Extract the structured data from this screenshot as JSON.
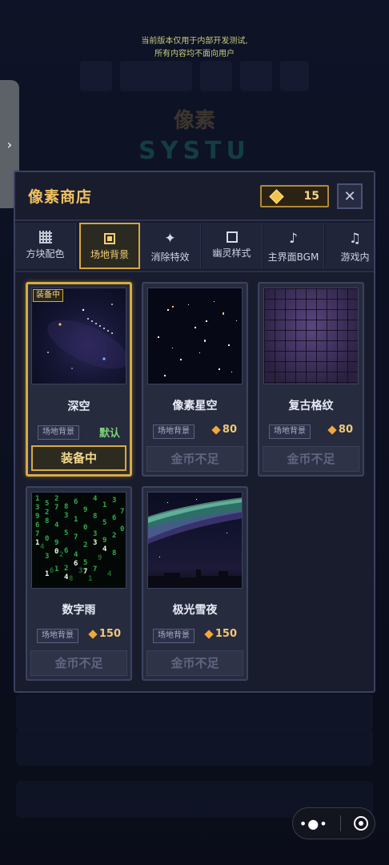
{
  "notice": {
    "line1": "当前版本仅用于内部开发测试,",
    "line2": "所有内容均不面向用户"
  },
  "side_tab": {
    "icon": "chevron-right-icon",
    "glyph": "›"
  },
  "background": {
    "title1": "像素",
    "title2": "SYSTU",
    "rows": [
      "",
      "",
      ""
    ]
  },
  "shop": {
    "title": "像素商店",
    "coins": "15",
    "close_glyph": "✕",
    "tabs": [
      {
        "label": "方块配色",
        "icon": "grid-icon"
      },
      {
        "label": "场地背景",
        "icon": "frame-icon",
        "active": true
      },
      {
        "label": "消除特效",
        "icon": "sparkle-icon",
        "glyph": "✦"
      },
      {
        "label": "幽灵样式",
        "icon": "square-outline-icon"
      },
      {
        "label": "主界面BGM",
        "icon": "music-note-icon",
        "glyph": "♪"
      },
      {
        "label": "游戏内",
        "icon": "music-notes-icon",
        "glyph": "♫"
      }
    ],
    "items": [
      {
        "name": "深空",
        "category": "场地背景",
        "status": "默认",
        "action": "装备中",
        "tag": "装备中",
        "equipped": true
      },
      {
        "name": "像素星空",
        "category": "场地背景",
        "price": "80",
        "action": "金币不足"
      },
      {
        "name": "复古格纹",
        "category": "场地背景",
        "price": "80",
        "action": "金币不足"
      },
      {
        "name": "数字雨",
        "category": "场地背景",
        "price": "150",
        "action": "金币不足"
      },
      {
        "name": "极光雪夜",
        "category": "场地背景",
        "price": "150",
        "action": "金币不足"
      }
    ]
  },
  "capsule": {
    "more_glyph": "•●•"
  },
  "colors": {
    "accent": "#d8aa3f",
    "coin": "#f4c34c",
    "default": "#7fd17a"
  }
}
